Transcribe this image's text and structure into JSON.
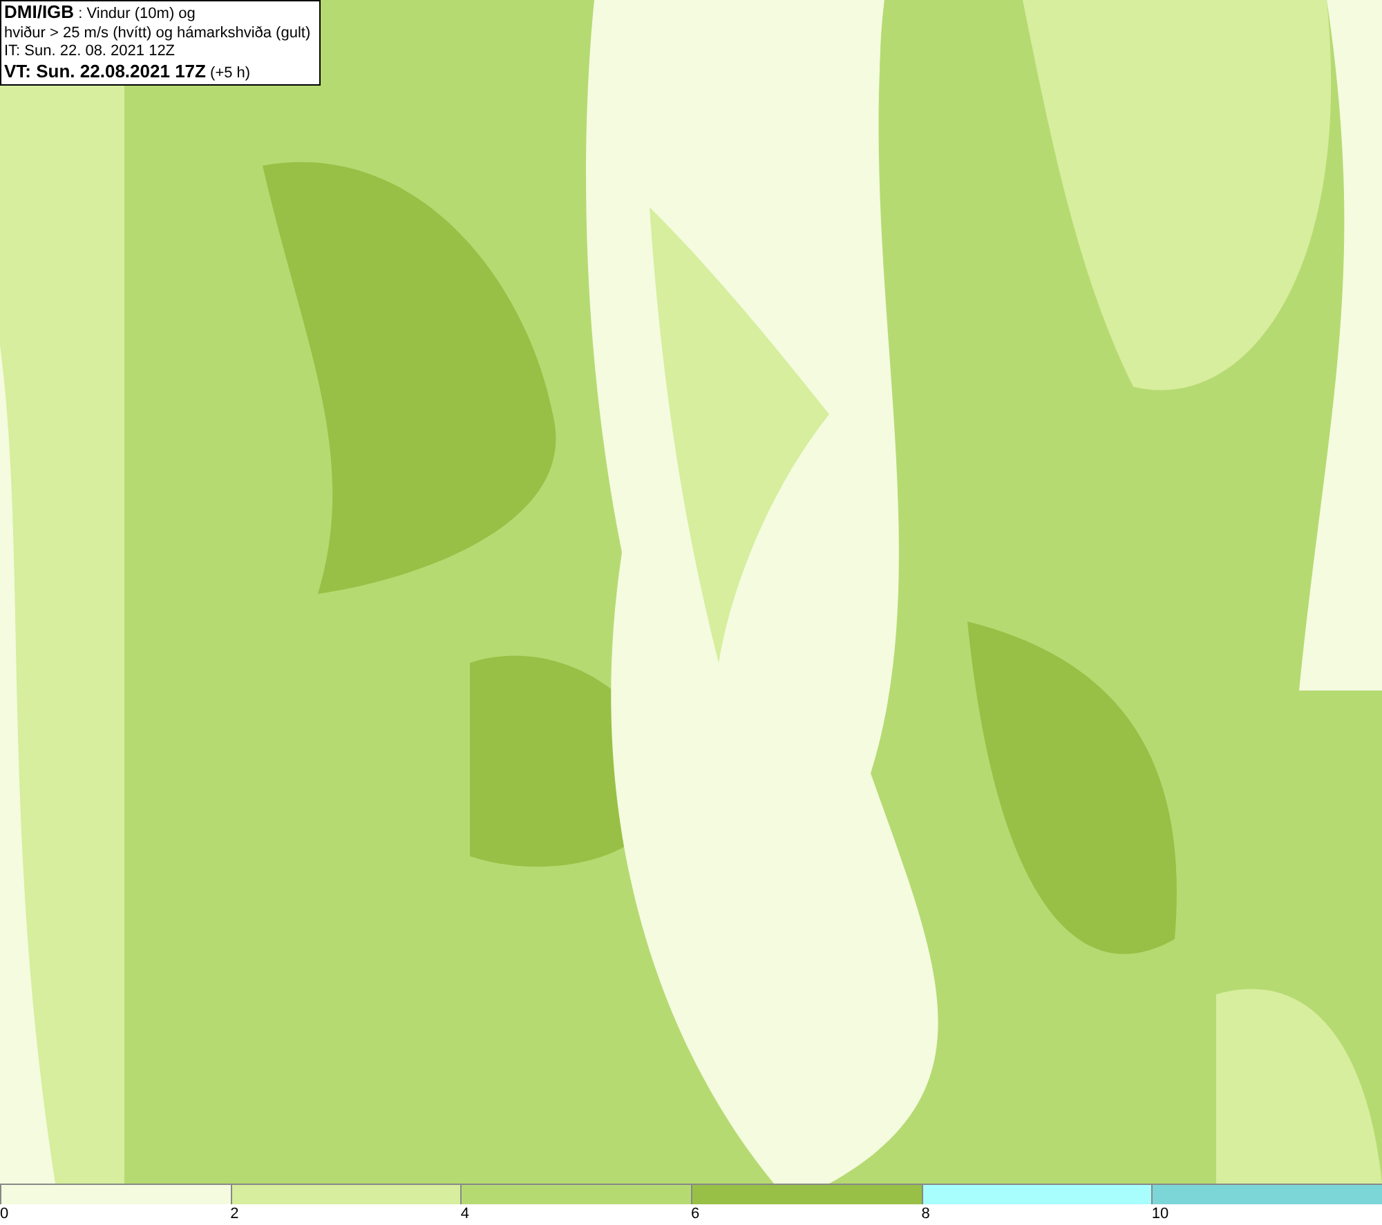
{
  "header": {
    "lines": [
      "**DMI/IGB** : Vindur (10m) og",
      "hviður > 25 m/s (hvítt) og hámarkshviða (gult)",
      "IT: Sun. 22. 08. 2021 12Z",
      "**VT: Sun. 22.08.2021 17Z** (+5 h)"
    ]
  },
  "legend": {
    "segments": [
      {
        "color": "#f4fbdf"
      },
      {
        "color": "#d6ee9d"
      },
      {
        "color": "#b6da72"
      },
      {
        "color": "#98c046"
      },
      {
        "color": "#a8fdfd"
      },
      {
        "color": "#7cd6d8"
      }
    ],
    "ticks": [
      "0",
      "2",
      "4",
      "6",
      "8",
      "10"
    ]
  }
}
